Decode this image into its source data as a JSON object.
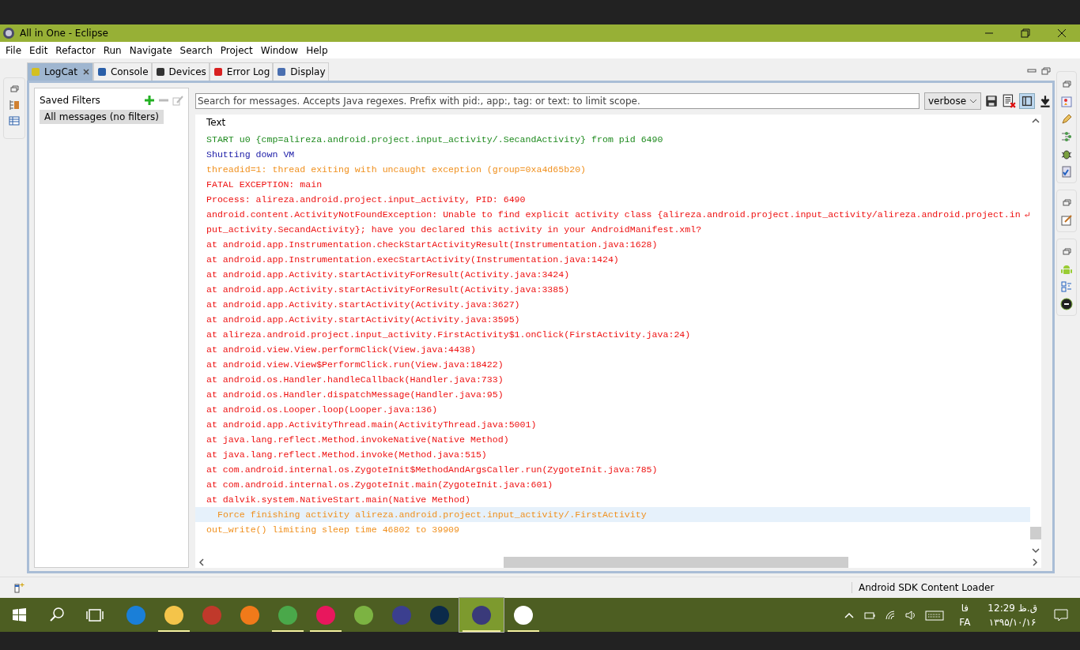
{
  "window": {
    "title": "All in One - Eclipse"
  },
  "menu": [
    "File",
    "Edit",
    "Refactor",
    "Run",
    "Navigate",
    "Search",
    "Project",
    "Window",
    "Help"
  ],
  "tabs": [
    {
      "label": "LogCat",
      "selected": true
    },
    {
      "label": "Console",
      "selected": false
    },
    {
      "label": "Devices",
      "selected": false
    },
    {
      "label": "Error Log",
      "selected": false
    },
    {
      "label": "Display",
      "selected": false
    }
  ],
  "filters": {
    "title": "Saved Filters",
    "items": [
      {
        "label": "All messages (no filters)",
        "selected": true
      }
    ]
  },
  "search": {
    "placeholder": "Search for messages. Accepts Java regexes. Prefix with pid:, app:, tag: or text: to limit scope."
  },
  "level_select": {
    "value": "verbose"
  },
  "log": {
    "column": "Text",
    "rows": [
      {
        "kind": "info",
        "text": "START u0 {cmp=alireza.android.project.input_activity/.SecandActivity} from pid 6490",
        "selected": false,
        "wrapped": false
      },
      {
        "kind": "debug",
        "text": "Shutting down VM",
        "selected": false,
        "wrapped": false
      },
      {
        "kind": "warn",
        "text": "threadid=1: thread exiting with uncaught exception (group=0xa4d65b20)",
        "selected": false,
        "wrapped": false
      },
      {
        "kind": "error",
        "text": "FATAL EXCEPTION: main",
        "selected": false,
        "wrapped": false
      },
      {
        "kind": "error",
        "text": "Process: alireza.android.project.input_activity, PID: 6490",
        "selected": false,
        "wrapped": false
      },
      {
        "kind": "error",
        "text": "android.content.ActivityNotFoundException: Unable to find explicit activity class {alireza.android.project.input_activity/alireza.android.project.in",
        "selected": false,
        "wrapped": true
      },
      {
        "kind": "error",
        "text": "put_activity.SecandActivity}; have you declared this activity in your AndroidManifest.xml?",
        "selected": false,
        "wrapped": false
      },
      {
        "kind": "error",
        "text": "at android.app.Instrumentation.checkStartActivityResult(Instrumentation.java:1628)",
        "selected": false,
        "wrapped": false
      },
      {
        "kind": "error",
        "text": "at android.app.Instrumentation.execStartActivity(Instrumentation.java:1424)",
        "selected": false,
        "wrapped": false
      },
      {
        "kind": "error",
        "text": "at android.app.Activity.startActivityForResult(Activity.java:3424)",
        "selected": false,
        "wrapped": false
      },
      {
        "kind": "error",
        "text": "at android.app.Activity.startActivityForResult(Activity.java:3385)",
        "selected": false,
        "wrapped": false
      },
      {
        "kind": "error",
        "text": "at android.app.Activity.startActivity(Activity.java:3627)",
        "selected": false,
        "wrapped": false
      },
      {
        "kind": "error",
        "text": "at android.app.Activity.startActivity(Activity.java:3595)",
        "selected": false,
        "wrapped": false
      },
      {
        "kind": "error",
        "text": "at alireza.android.project.input_activity.FirstActivity$1.onClick(FirstActivity.java:24)",
        "selected": false,
        "wrapped": false
      },
      {
        "kind": "error",
        "text": "at android.view.View.performClick(View.java:4438)",
        "selected": false,
        "wrapped": false
      },
      {
        "kind": "error",
        "text": "at android.view.View$PerformClick.run(View.java:18422)",
        "selected": false,
        "wrapped": false
      },
      {
        "kind": "error",
        "text": "at android.os.Handler.handleCallback(Handler.java:733)",
        "selected": false,
        "wrapped": false
      },
      {
        "kind": "error",
        "text": "at android.os.Handler.dispatchMessage(Handler.java:95)",
        "selected": false,
        "wrapped": false
      },
      {
        "kind": "error",
        "text": "at android.os.Looper.loop(Looper.java:136)",
        "selected": false,
        "wrapped": false
      },
      {
        "kind": "error",
        "text": "at android.app.ActivityThread.main(ActivityThread.java:5001)",
        "selected": false,
        "wrapped": false
      },
      {
        "kind": "error",
        "text": "at java.lang.reflect.Method.invokeNative(Native Method)",
        "selected": false,
        "wrapped": false
      },
      {
        "kind": "error",
        "text": "at java.lang.reflect.Method.invoke(Method.java:515)",
        "selected": false,
        "wrapped": false
      },
      {
        "kind": "error",
        "text": "at com.android.internal.os.ZygoteInit$MethodAndArgsCaller.run(ZygoteInit.java:785)",
        "selected": false,
        "wrapped": false
      },
      {
        "kind": "error",
        "text": "at com.android.internal.os.ZygoteInit.main(ZygoteInit.java:601)",
        "selected": false,
        "wrapped": false
      },
      {
        "kind": "error",
        "text": "at dalvik.system.NativeStart.main(Native Method)",
        "selected": false,
        "wrapped": false
      },
      {
        "kind": "warn",
        "text": "Force finishing activity alireza.android.project.input_activity/.FirstActivity",
        "selected": true,
        "wrapped": false
      },
      {
        "kind": "warn",
        "text": "out_write() limiting sleep time 46802 to 39909",
        "selected": false,
        "wrapped": false
      }
    ]
  },
  "status_bar": {
    "task": "Android SDK Content Loader"
  },
  "taskbar": {
    "apps": [
      {
        "running": false,
        "selected": false
      },
      {
        "running": true,
        "selected": false
      },
      {
        "running": false,
        "selected": false
      },
      {
        "running": false,
        "selected": false
      },
      {
        "running": true,
        "selected": false
      },
      {
        "running": true,
        "selected": false
      },
      {
        "running": false,
        "selected": false
      },
      {
        "running": false,
        "selected": false
      },
      {
        "running": false,
        "selected": false
      },
      {
        "running": true,
        "selected": true
      },
      {
        "running": true,
        "selected": false
      }
    ],
    "language_short": "فا",
    "language": "FA",
    "time": "12:29 ق.ظ",
    "date": "۱۳۹۵/۱۰/۱۶"
  }
}
